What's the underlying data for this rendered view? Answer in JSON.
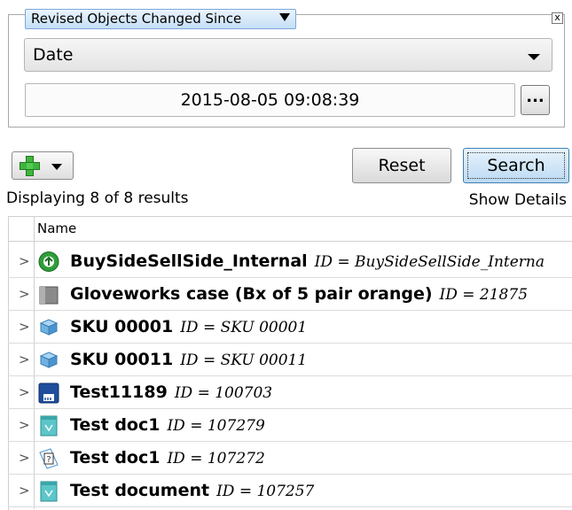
{
  "filter": {
    "type_label": "Revised Objects Changed Since",
    "close_label": "x",
    "field_value": "Date",
    "date_value": "2015-08-05 09:08:39",
    "ellipsis_label": "..."
  },
  "toolbar": {
    "reset_label": "Reset",
    "search_label": "Search"
  },
  "results": {
    "count_text": "Displaying 8 of 8 results",
    "show_details_label": "Show Details",
    "column_header": "Name",
    "rows": [
      {
        "name": "BuySideSellSide_Internal",
        "id": "ID = BuySideSellSide_Interna",
        "icon": "workflow-icon"
      },
      {
        "name": "Gloveworks case (Bx of 5 pair orange)",
        "id": "ID = 21875",
        "icon": "case-icon"
      },
      {
        "name": "SKU 00001",
        "id": "ID = SKU 00001",
        "icon": "sku-icon"
      },
      {
        "name": "SKU 00011",
        "id": "ID = SKU 00011",
        "icon": "sku-icon"
      },
      {
        "name": "Test11189",
        "id": "ID = 100703",
        "icon": "floppy-icon"
      },
      {
        "name": "Test doc1",
        "id": "ID = 107279",
        "icon": "document-icon"
      },
      {
        "name": "Test doc1",
        "id": "ID = 107272",
        "icon": "unknown-document-icon"
      },
      {
        "name": "Test document",
        "id": "ID = 107257",
        "icon": "document-icon"
      }
    ]
  },
  "colors": {
    "accent_blue": "#bcdaf3",
    "button_border": "#3c7fb1"
  }
}
